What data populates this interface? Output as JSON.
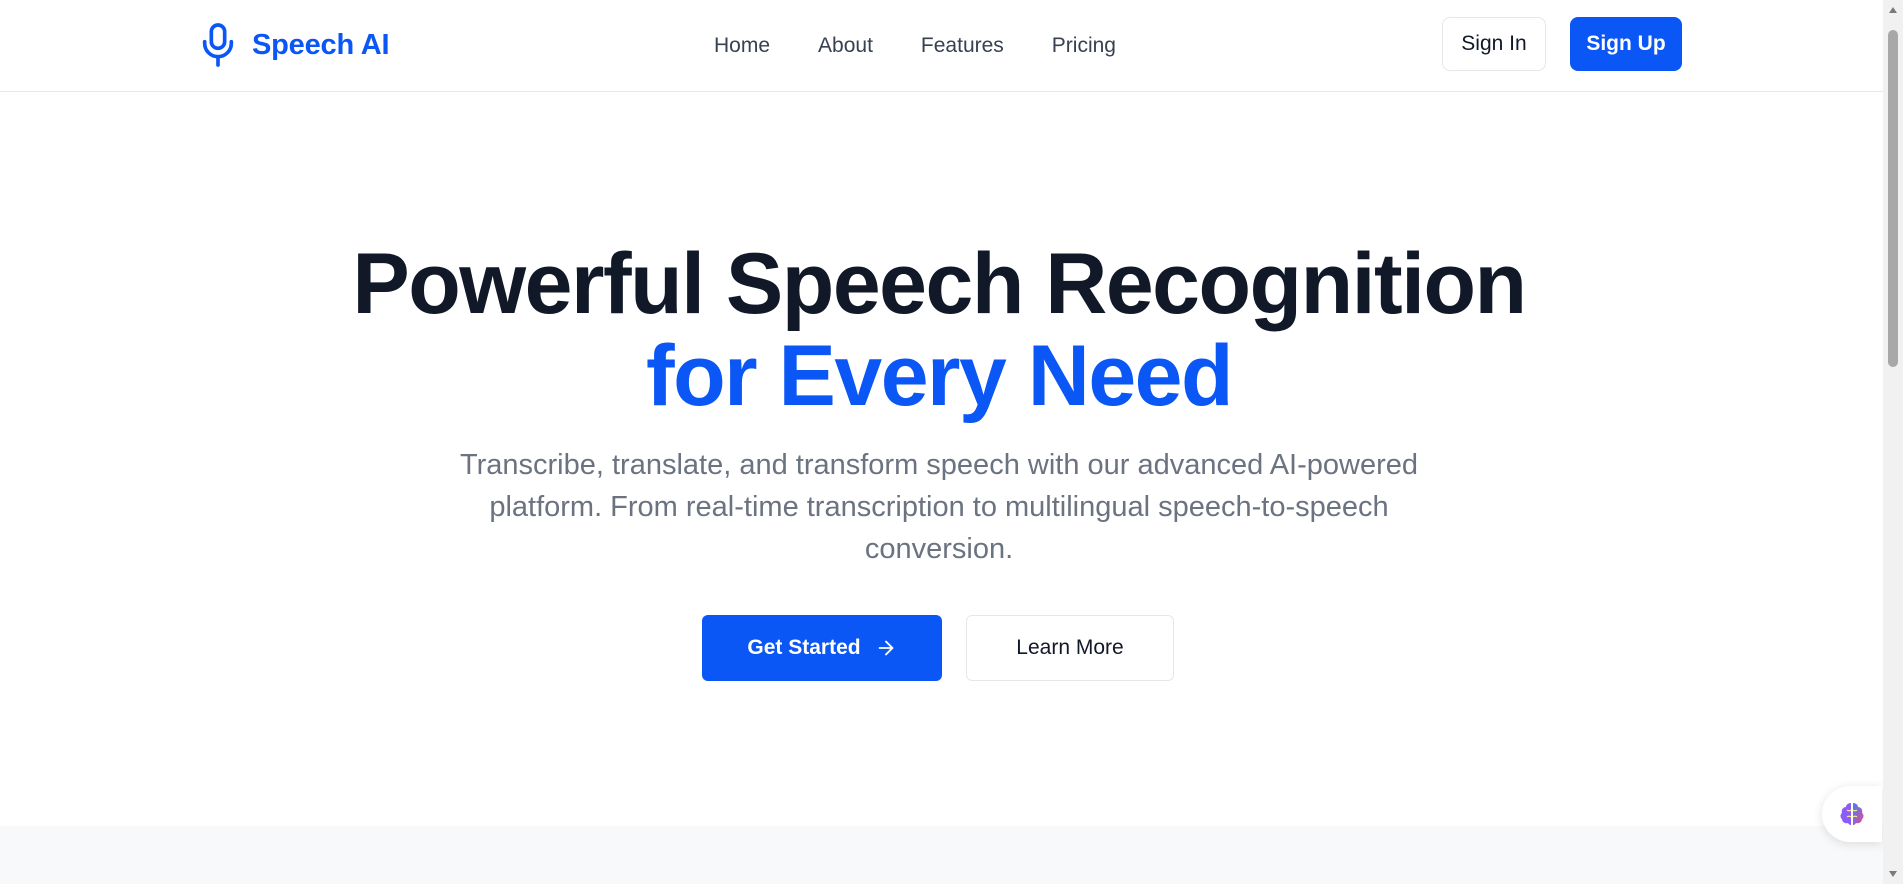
{
  "brand": {
    "name": "Speech AI",
    "icon": "microphone-icon",
    "color": "#0b57f5"
  },
  "nav": {
    "items": [
      {
        "label": "Home"
      },
      {
        "label": "About"
      },
      {
        "label": "Features"
      },
      {
        "label": "Pricing"
      }
    ]
  },
  "auth": {
    "sign_in_label": "Sign In",
    "sign_up_label": "Sign Up"
  },
  "hero": {
    "title_line1": "Powerful Speech Recognition",
    "title_line2": "for Every Need",
    "subtitle": "Transcribe, translate, and transform speech with our advanced AI-powered platform. From real-time transcription to multilingual speech-to-speech conversion.",
    "primary_cta": "Get Started",
    "primary_cta_icon": "arrow-right-icon",
    "secondary_cta": "Learn More"
  },
  "widget": {
    "icon": "brain-icon"
  },
  "colors": {
    "accent": "#0b57f5",
    "heading": "#111827",
    "muted_text": "#6b7280",
    "border": "#e5e7eb"
  }
}
